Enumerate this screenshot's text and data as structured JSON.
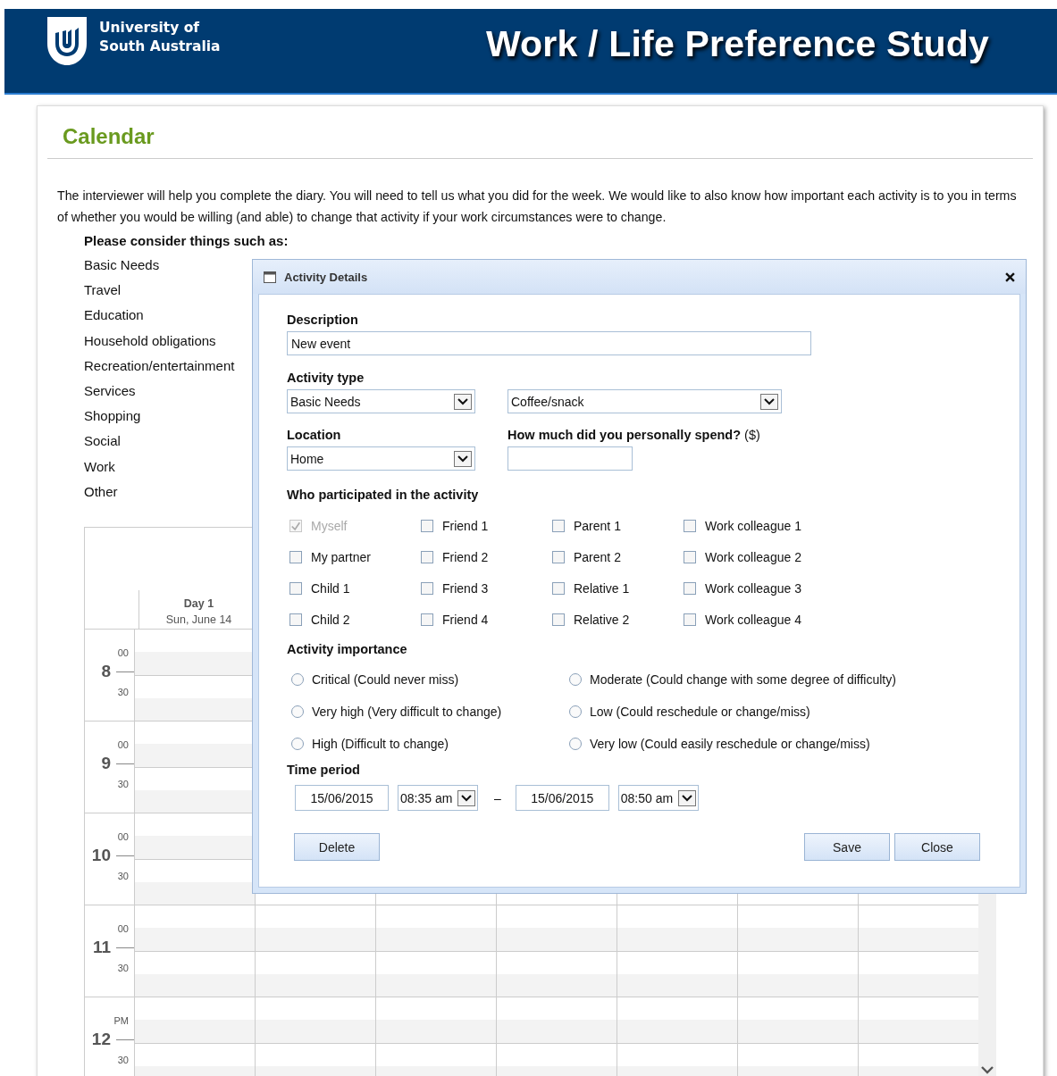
{
  "header": {
    "logo_lines": [
      "University of",
      "South Australia"
    ],
    "title": "Work / Life Preference Study"
  },
  "page": {
    "heading": "Calendar",
    "intro": "The interviewer will help you complete the diary. You will need to tell us what you did for the week. We would like to also know how important each activity is to you in terms of whether you would be willing (and able) to change that activity if your work circumstances were to change.",
    "consider_heading": "Please consider things such as:",
    "consider_items": [
      "Basic Needs",
      "Travel",
      "Education",
      "Household obligations",
      "Recreation/entertainment",
      "Services",
      "Shopping",
      "Social",
      "Work",
      "Other"
    ]
  },
  "calendar": {
    "days": [
      {
        "label": "Day 1",
        "date": "Sun, June 14"
      }
    ],
    "hours": [
      {
        "hour": "8",
        "first": "00",
        "second": "30"
      },
      {
        "hour": "9",
        "first": "00",
        "second": "30"
      },
      {
        "hour": "10",
        "first": "00",
        "second": "30"
      },
      {
        "hour": "11",
        "first": "00",
        "second": "30"
      },
      {
        "hour": "12",
        "first": "PM",
        "second": "30"
      }
    ]
  },
  "dialog": {
    "title": "Activity Details",
    "description": {
      "label": "Description",
      "value": "New event"
    },
    "activity_type": {
      "label": "Activity type",
      "values": [
        "Basic Needs",
        "Coffee/snack"
      ]
    },
    "location": {
      "label": "Location",
      "value": "Home"
    },
    "spend": {
      "label": "**How much did you personally spend?** ($)"
    },
    "participants": {
      "label": "Who participated in the activity",
      "options": [
        {
          "label": "Myself",
          "checked": true,
          "disabled": true
        },
        {
          "label": "Friend 1",
          "checked": false,
          "disabled": false
        },
        {
          "label": "Parent 1",
          "checked": false,
          "disabled": false
        },
        {
          "label": "Work colleague 1",
          "checked": false,
          "disabled": false
        },
        {
          "label": "My partner",
          "checked": false,
          "disabled": false
        },
        {
          "label": "Friend 2",
          "checked": false,
          "disabled": false
        },
        {
          "label": "Parent 2",
          "checked": false,
          "disabled": false
        },
        {
          "label": "Work colleague 2",
          "checked": false,
          "disabled": false
        },
        {
          "label": "Child 1",
          "checked": false,
          "disabled": false
        },
        {
          "label": "Friend 3",
          "checked": false,
          "disabled": false
        },
        {
          "label": "Relative 1",
          "checked": false,
          "disabled": false
        },
        {
          "label": "Work colleague 3",
          "checked": false,
          "disabled": false
        },
        {
          "label": "Child 2",
          "checked": false,
          "disabled": false
        },
        {
          "label": "Friend 4",
          "checked": false,
          "disabled": false
        },
        {
          "label": "Relative 2",
          "checked": false,
          "disabled": false
        },
        {
          "label": "Work colleague 4",
          "checked": false,
          "disabled": false
        }
      ]
    },
    "importance": {
      "label": "Activity importance",
      "options": [
        {
          "label": "Critical (Could never miss)",
          "selected": false
        },
        {
          "label": "Very high (Very difficult to change)",
          "selected": false
        },
        {
          "label": "High (Difficult to change)",
          "selected": false
        },
        {
          "label": "Moderate (Could change with some degree of difficulty)",
          "selected": false
        },
        {
          "label": "Low (Could reschedule or change/miss)",
          "selected": false
        },
        {
          "label": "Very low (Could easily reschedule or change/miss)",
          "selected": false
        }
      ]
    },
    "time_period": {
      "label": "Time period",
      "start_date": "15/06/2015",
      "start_time": "08:35 am",
      "separator": "–",
      "end_date": "15/06/2015",
      "end_time": "08:50 am"
    },
    "buttons": [
      "Delete",
      "Save",
      "Close"
    ]
  }
}
